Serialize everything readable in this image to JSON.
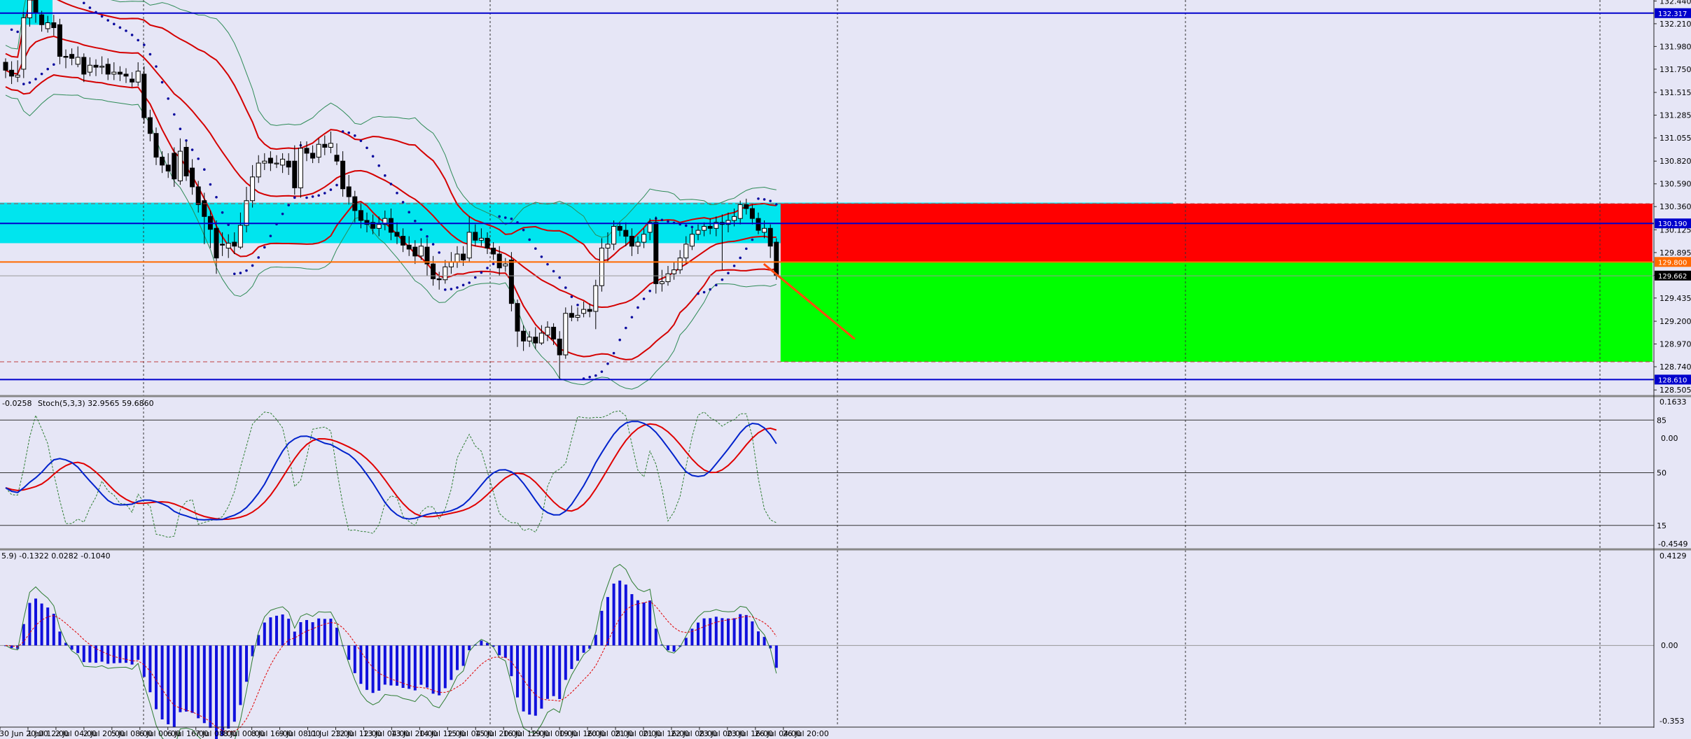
{
  "chart_data": {
    "type": "candlestick",
    "symbol_hidden": true,
    "colors": {
      "background": "#e6e6f6",
      "bull": "#ffffff",
      "bear": "#000000",
      "band_red": "#d40000",
      "band_green": "#2e8b57",
      "sar": "#0a0a9e",
      "cyan_zone": "#00e5ee",
      "sell_zone": "#ff0000",
      "target_zone": "#00ff00",
      "line_blue": "#0000cc",
      "line_orange": "#ff6a00",
      "stoch_main": "#0022cc",
      "stoch_signal": "#e00000",
      "hist": "#1010dd"
    },
    "price_axis": {
      "ylim": [
        128.45,
        132.45
      ],
      "ticks": [
        "132.440",
        "132.210",
        "131.980",
        "131.750",
        "131.515",
        "131.285",
        "131.055",
        "130.820",
        "130.590",
        "130.360",
        "130.125",
        "129.895",
        "129.665",
        "129.435",
        "129.200",
        "128.970",
        "128.740",
        "128.505"
      ]
    },
    "price_tags": {
      "top_line": "132.317",
      "mid_line": "130.190",
      "orange_line": "129.800",
      "current": "129.662",
      "bottom_line": "128.610"
    },
    "levels": {
      "top_line": 132.317,
      "mid_line": 130.19,
      "orange_line": 129.8,
      "bottom_line": 128.61,
      "dash_upper": 130.39,
      "dash_lower": 128.79,
      "cyan_zone": [
        129.99,
        130.4
      ],
      "sell_zone": [
        129.8,
        130.39
      ],
      "target_zone": [
        128.79,
        129.8
      ]
    },
    "x_labels": [
      "30 Jun 20:00",
      "1 Jul 12:00",
      "2 Jul 04:00",
      "2 Jul 20:00",
      "5 Jul 08:00",
      "6 Jul 00:00",
      "6 Jul 16:00",
      "7 Jul 08:00",
      "8 Jul 00:00",
      "8 Jul 16:00",
      "9 Jul 08:00",
      "11 Jul 23:00",
      "12 Jul 12:00",
      "13 Jul 04:00",
      "13 Jul 20:00",
      "14 Jul 12:00",
      "15 Jul 04:00",
      "15 Jul 20:00",
      "16 Jul 12:00",
      "19 Jul 00:00",
      "19 Jul 16:00",
      "20 Jul 08:00",
      "21 Jul 00:00",
      "21 Jul 16:00",
      "22 Jul 08:00",
      "23 Jul 00:00",
      "23 Jul 16:00",
      "26 Jul 04:00",
      "26 Jul 20:00"
    ],
    "candles": [
      [
        131.82,
        131.74,
        131.86,
        131.66
      ],
      [
        131.74,
        131.68,
        131.83,
        131.6
      ],
      [
        131.67,
        131.69,
        131.84,
        131.62
      ],
      [
        131.75,
        132.27,
        132.33,
        131.66
      ],
      [
        132.27,
        132.45,
        132.5,
        132.18
      ],
      [
        132.45,
        132.32,
        132.52,
        132.22
      ],
      [
        132.3,
        132.2,
        132.34,
        132.13
      ],
      [
        132.16,
        132.22,
        132.29,
        132.12
      ],
      [
        132.22,
        132.17,
        132.3,
        132.09
      ],
      [
        132.2,
        131.88,
        132.26,
        131.8
      ],
      [
        131.88,
        131.87,
        131.95,
        131.76
      ],
      [
        131.9,
        131.86,
        131.96,
        131.79
      ],
      [
        131.8,
        131.87,
        131.98,
        131.77
      ],
      [
        131.87,
        131.7,
        131.91,
        131.62
      ],
      [
        131.72,
        131.79,
        131.87,
        131.68
      ],
      [
        131.79,
        131.77,
        131.85,
        131.68
      ],
      [
        131.77,
        131.78,
        131.88,
        131.7
      ],
      [
        131.8,
        131.7,
        131.86,
        131.64
      ],
      [
        131.7,
        131.72,
        131.82,
        131.64
      ],
      [
        131.72,
        131.7,
        131.78,
        131.63
      ],
      [
        131.7,
        131.68,
        131.76,
        131.61
      ],
      [
        131.65,
        131.62,
        131.72,
        131.57
      ],
      [
        131.62,
        131.73,
        131.82,
        131.58
      ],
      [
        131.7,
        131.26,
        131.78,
        131.2
      ],
      [
        131.26,
        131.1,
        131.34,
        131.02
      ],
      [
        131.1,
        130.86,
        131.16,
        130.78
      ],
      [
        130.86,
        130.78,
        130.92,
        130.7
      ],
      [
        130.78,
        130.72,
        130.9,
        130.65
      ],
      [
        130.9,
        130.64,
        130.96,
        130.56
      ],
      [
        130.62,
        130.92,
        131.05,
        130.58
      ],
      [
        130.96,
        130.67,
        131.02,
        130.62
      ],
      [
        130.75,
        130.56,
        130.84,
        130.48
      ],
      [
        130.56,
        130.38,
        130.62,
        130.3
      ],
      [
        130.42,
        130.26,
        130.5,
        129.98
      ],
      [
        130.26,
        130.13,
        130.32,
        129.94
      ],
      [
        130.14,
        129.84,
        130.22,
        129.68
      ],
      [
        129.98,
        129.97,
        130.1,
        129.86
      ],
      [
        129.94,
        129.99,
        130.08,
        129.84
      ],
      [
        130.0,
        129.96,
        130.1,
        129.88
      ],
      [
        129.95,
        130.17,
        130.3,
        129.93
      ],
      [
        130.17,
        130.42,
        130.56,
        130.1
      ],
      [
        130.42,
        130.66,
        130.78,
        130.35
      ],
      [
        130.66,
        130.8,
        130.88,
        130.6
      ],
      [
        130.8,
        130.82,
        130.9,
        130.73
      ],
      [
        130.85,
        130.8,
        130.92,
        130.72
      ],
      [
        130.8,
        130.8,
        130.88,
        130.75
      ],
      [
        130.78,
        130.84,
        130.9,
        130.7
      ],
      [
        130.82,
        130.76,
        130.9,
        130.68
      ],
      [
        130.82,
        130.55,
        130.98,
        130.48
      ],
      [
        130.55,
        130.95,
        131.02,
        130.45
      ],
      [
        130.95,
        130.9,
        131.02,
        130.82
      ],
      [
        130.9,
        130.85,
        130.98,
        130.8
      ],
      [
        130.86,
        130.99,
        131.05,
        130.8
      ],
      [
        130.99,
        130.96,
        131.08,
        130.88
      ],
      [
        130.96,
        131.0,
        131.12,
        130.9
      ],
      [
        130.88,
        130.82,
        131.0,
        130.78
      ],
      [
        130.82,
        130.54,
        130.92,
        130.46
      ],
      [
        130.56,
        130.46,
        130.68,
        130.38
      ],
      [
        130.46,
        130.32,
        130.52,
        130.2
      ],
      [
        130.32,
        130.22,
        130.4,
        130.14
      ],
      [
        130.22,
        130.18,
        130.3,
        130.1
      ],
      [
        130.2,
        130.14,
        130.28,
        130.08
      ],
      [
        130.14,
        130.18,
        130.26,
        130.06
      ],
      [
        130.18,
        130.24,
        130.32,
        130.12
      ],
      [
        130.24,
        130.1,
        130.34,
        130.02
      ],
      [
        130.1,
        130.06,
        130.2,
        129.98
      ],
      [
        130.06,
        129.97,
        130.14,
        129.9
      ],
      [
        129.97,
        129.93,
        130.06,
        129.86
      ],
      [
        129.95,
        129.86,
        130.02,
        129.78
      ],
      [
        129.86,
        129.96,
        130.04,
        129.82
      ],
      [
        129.95,
        129.78,
        130.04,
        129.66
      ],
      [
        129.78,
        129.63,
        129.86,
        129.56
      ],
      [
        129.63,
        129.62,
        129.7,
        129.52
      ],
      [
        129.62,
        129.75,
        129.82,
        129.58
      ],
      [
        129.75,
        129.8,
        129.9,
        129.68
      ],
      [
        129.8,
        129.88,
        129.96,
        129.74
      ],
      [
        129.88,
        129.82,
        129.96,
        129.76
      ],
      [
        129.84,
        130.1,
        130.26,
        129.8
      ],
      [
        130.1,
        130.02,
        130.18,
        129.96
      ],
      [
        130.02,
        130.04,
        130.14,
        129.96
      ],
      [
        130.04,
        129.94,
        130.1,
        129.88
      ],
      [
        129.94,
        129.88,
        130.0,
        129.82
      ],
      [
        129.88,
        129.74,
        129.96,
        129.66
      ],
      [
        129.76,
        129.78,
        129.84,
        129.7
      ],
      [
        129.82,
        129.38,
        129.9,
        129.3
      ],
      [
        129.38,
        129.1,
        129.42,
        128.94
      ],
      [
        129.1,
        129.0,
        129.16,
        128.9
      ],
      [
        129.0,
        129.04,
        129.1,
        128.94
      ],
      [
        129.04,
        128.98,
        129.14,
        128.92
      ],
      [
        128.98,
        129.08,
        129.16,
        128.96
      ],
      [
        129.06,
        129.14,
        129.2,
        129.0
      ],
      [
        129.14,
        129.02,
        129.18,
        128.96
      ],
      [
        129.02,
        128.86,
        129.1,
        128.62
      ],
      [
        128.86,
        129.28,
        129.34,
        128.82
      ],
      [
        129.28,
        129.24,
        129.36,
        129.2
      ],
      [
        129.24,
        129.26,
        129.34,
        129.2
      ],
      [
        129.28,
        129.32,
        129.4,
        129.24
      ],
      [
        129.32,
        129.3,
        129.38,
        129.24
      ],
      [
        129.3,
        129.56,
        129.62,
        129.12
      ],
      [
        129.56,
        129.94,
        130.04,
        129.5
      ],
      [
        129.94,
        129.98,
        130.1,
        129.8
      ],
      [
        129.98,
        130.16,
        130.22,
        129.92
      ],
      [
        130.16,
        130.12,
        130.2,
        130.06
      ],
      [
        130.12,
        130.06,
        130.2,
        129.96
      ],
      [
        130.06,
        129.96,
        130.14,
        129.86
      ],
      [
        129.96,
        130.0,
        130.06,
        129.88
      ],
      [
        130.0,
        130.08,
        130.14,
        129.94
      ],
      [
        130.1,
        130.2,
        130.24,
        130.02
      ],
      [
        130.2,
        129.58,
        130.26,
        129.48
      ],
      [
        129.58,
        129.6,
        129.72,
        129.5
      ],
      [
        129.6,
        129.68,
        129.76,
        129.56
      ],
      [
        129.68,
        129.72,
        129.8,
        129.62
      ],
      [
        129.72,
        129.84,
        129.92,
        129.68
      ],
      [
        129.84,
        129.98,
        130.06,
        129.78
      ],
      [
        129.96,
        130.08,
        130.14,
        129.92
      ],
      [
        130.08,
        130.12,
        130.18,
        130.02
      ],
      [
        130.12,
        130.16,
        130.2,
        130.06
      ],
      [
        130.16,
        130.14,
        130.24,
        130.08
      ],
      [
        130.14,
        130.2,
        130.26,
        130.06
      ],
      [
        130.2,
        130.18,
        130.28,
        129.72
      ],
      [
        130.18,
        130.22,
        130.3,
        130.1
      ],
      [
        130.22,
        130.26,
        130.34,
        130.16
      ],
      [
        130.24,
        130.38,
        130.42,
        130.18
      ],
      [
        130.38,
        130.34,
        130.44,
        130.28
      ],
      [
        130.34,
        130.24,
        130.38,
        130.18
      ],
      [
        130.24,
        130.12,
        130.3,
        130.08
      ],
      [
        130.1,
        130.14,
        130.22,
        130.04
      ],
      [
        130.14,
        129.96,
        130.18,
        129.84
      ],
      [
        130.0,
        129.66,
        130.04,
        129.62
      ]
    ],
    "stochastic": {
      "label": "Stoch(5,3,3) 32.9565 59.6860",
      "ylim": [
        0,
        100
      ],
      "ticks": [
        "85",
        "50",
        "15"
      ],
      "levels": [
        85,
        50,
        15
      ]
    },
    "macd": {
      "label": "5.9) -0.1322 0.0282 -0.1040",
      "ticks_top": "0.4129",
      "ticks_zero": "0.00",
      "ticks_bottom": "-0.353"
    },
    "side_values": {
      "stoch_top": "0.1633",
      "stoch_mid": "0.00",
      "stoch_bottom": "-0.4549",
      "prefix": "-0.0258"
    }
  }
}
